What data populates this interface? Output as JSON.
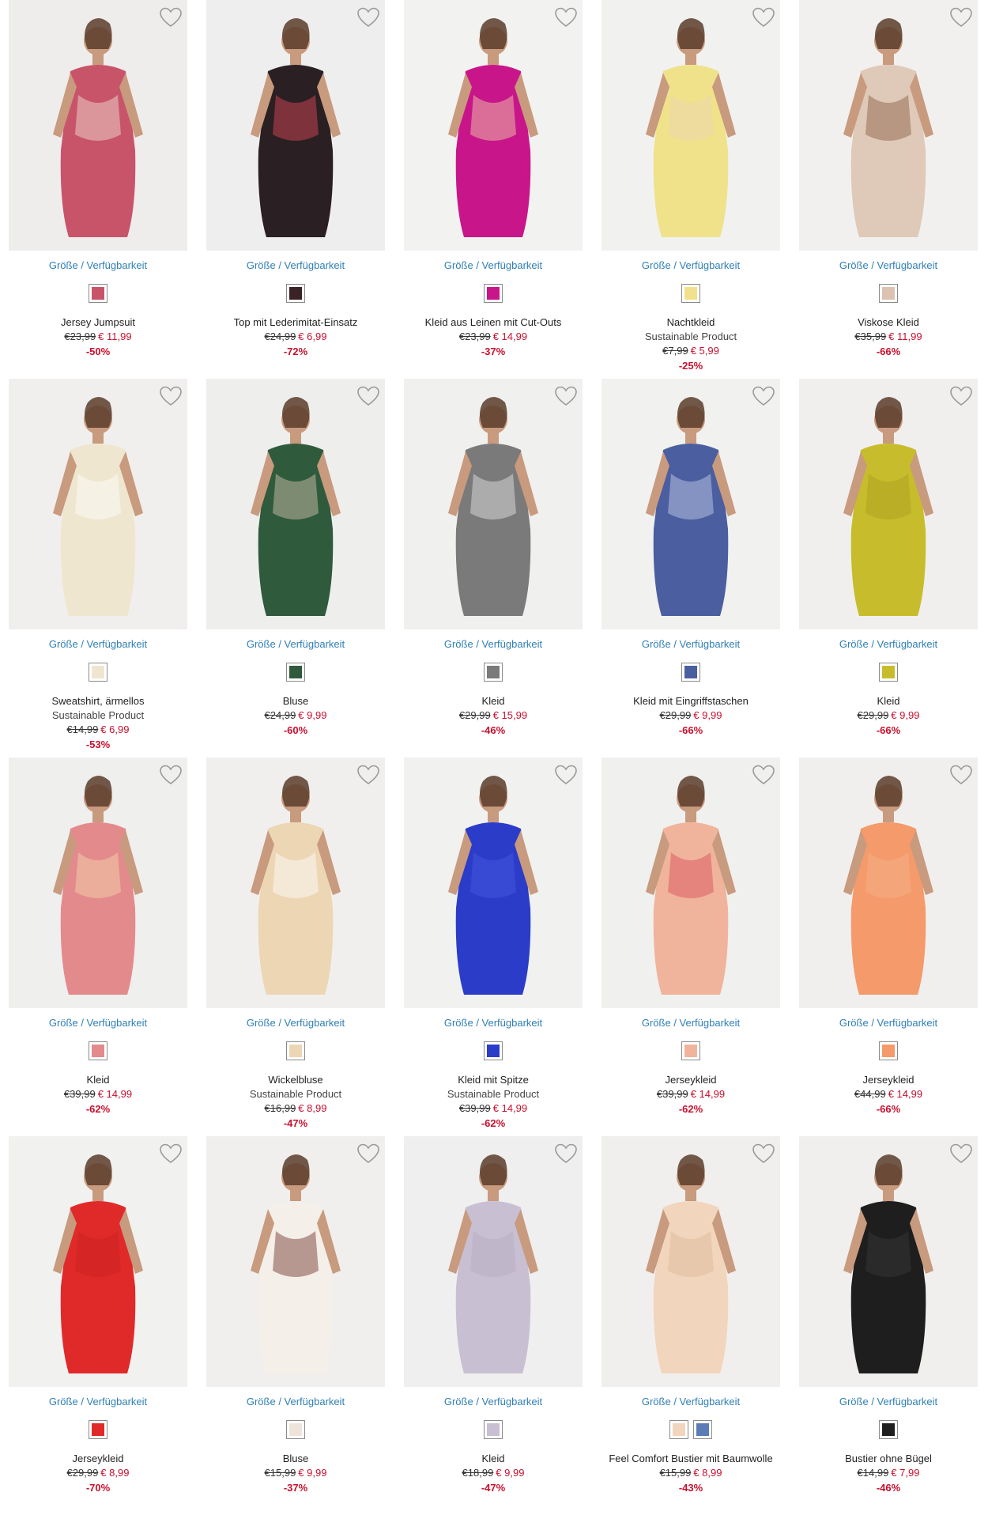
{
  "size_link_label": "Größe / Verfügbarkeit",
  "colors": {
    "link": "#2f7fb5",
    "sale": "#c8102e"
  },
  "products": [
    {
      "name": "Jersey Jumpsuit",
      "sub": "",
      "old": "€23,99",
      "new": "€ 11,99",
      "disc": "-50%",
      "bg": "#efedec",
      "fill": "#c8546a",
      "accent": "#f2e6d6",
      "swatches": [
        "#c8546a"
      ]
    },
    {
      "name": "Top mit Lederimitat-Einsatz",
      "sub": "",
      "old": "€24,99",
      "new": "€ 6,99",
      "disc": "-72%",
      "bg": "#eeeeee",
      "fill": "#2a1f22",
      "accent": "#e5495b",
      "swatches": [
        "#3a2226"
      ]
    },
    {
      "name": "Kleid aus Leinen mit Cut-Outs",
      "sub": "",
      "old": "€23,99",
      "new": "€ 14,99",
      "disc": "-37%",
      "bg": "#f2f2f0",
      "fill": "#c8168a",
      "accent": "#f0d9a8",
      "swatches": [
        "#c8168a"
      ]
    },
    {
      "name": "Nachtkleid",
      "sub": "Sustainable Product",
      "old": "€7,99",
      "new": "€ 5,99",
      "disc": "-25%",
      "bg": "#f1f1f0",
      "fill": "#f0e28a",
      "accent": "#e9d5b4",
      "swatches": [
        "#f2e18c"
      ]
    },
    {
      "name": "Viskose Kleid",
      "sub": "",
      "old": "€35,99",
      "new": "€ 11,99",
      "disc": "-66%",
      "bg": "#f1f0ee",
      "fill": "#dfc9b8",
      "accent": "#8a5a40",
      "swatches": [
        "#dcc2b0"
      ]
    },
    {
      "name": "Sweatshirt, ärmellos",
      "sub": "Sustainable Product",
      "old": "€14,99",
      "new": "€ 6,99",
      "disc": "-53%",
      "bg": "#f0efed",
      "fill": "#efe6cf",
      "accent": "#ffffff",
      "swatches": [
        "#efe6cf"
      ]
    },
    {
      "name": "Bluse",
      "sub": "",
      "old": "€24,99",
      "new": "€ 9,99",
      "disc": "-60%",
      "bg": "#eeeeec",
      "fill": "#2f5a3c",
      "accent": "#e0c8b6",
      "swatches": [
        "#2f5a3c"
      ]
    },
    {
      "name": "Kleid",
      "sub": "",
      "old": "€29,99",
      "new": "€ 15,99",
      "disc": "-46%",
      "bg": "#f0f0ee",
      "fill": "#7a7a7a",
      "accent": "#e8e8e8",
      "swatches": [
        "#7a7a7a"
      ]
    },
    {
      "name": "Kleid mit Eingriffstaschen",
      "sub": "",
      "old": "€29,99",
      "new": "€ 9,99",
      "disc": "-66%",
      "bg": "#f1f1f0",
      "fill": "#4a5ea0",
      "accent": "#cfd5ea",
      "swatches": [
        "#4a5ea0"
      ]
    },
    {
      "name": "Kleid",
      "sub": "",
      "old": "€29,99",
      "new": "€ 9,99",
      "disc": "-66%",
      "bg": "#f0efed",
      "fill": "#c7bd2c",
      "accent": "#a89c20",
      "swatches": [
        "#c7bd2c"
      ]
    },
    {
      "name": "Kleid",
      "sub": "",
      "old": "€39,99",
      "new": "€ 14,99",
      "disc": "-62%",
      "bg": "#efefee",
      "fill": "#e38a8d",
      "accent": "#f1d9ad",
      "swatches": [
        "#e38a8d"
      ]
    },
    {
      "name": "Wickelbluse",
      "sub": "Sustainable Product",
      "old": "€16,99",
      "new": "€ 8,99",
      "disc": "-47%",
      "bg": "#f0efed",
      "fill": "#ecd6b4",
      "accent": "#ffffff",
      "swatches": [
        "#ecd6b4"
      ]
    },
    {
      "name": "Kleid mit Spitze",
      "sub": "Sustainable Product",
      "old": "€39,99",
      "new": "€ 14,99",
      "disc": "-62%",
      "bg": "#f1f1f0",
      "fill": "#2b3dc8",
      "accent": "#4a5be0",
      "swatches": [
        "#2b3dc8"
      ]
    },
    {
      "name": "Jerseykleid",
      "sub": "",
      "old": "€39,99",
      "new": "€ 14,99",
      "disc": "-62%",
      "bg": "#f0f0ee",
      "fill": "#f0b49c",
      "accent": "#d84a58",
      "swatches": [
        "#f0b49c"
      ]
    },
    {
      "name": "Jerseykleid",
      "sub": "",
      "old": "€44,99",
      "new": "€ 14,99",
      "disc": "-66%",
      "bg": "#f0efed",
      "fill": "#f49a6b",
      "accent": "#f7b48e",
      "swatches": [
        "#f49a6b"
      ]
    },
    {
      "name": "Jerseykleid",
      "sub": "",
      "old": "€29,99",
      "new": "€ 8,99",
      "disc": "-70%",
      "bg": "#f1f1f0",
      "fill": "#e02a2a",
      "accent": "#c81e1e",
      "swatches": [
        "#e02a2a"
      ]
    },
    {
      "name": "Bluse",
      "sub": "",
      "old": "€15,99",
      "new": "€ 9,99",
      "disc": "-37%",
      "bg": "#f0efed",
      "fill": "#f4efe8",
      "accent": "#6a2e28",
      "swatches": [
        "#efe4dc"
      ]
    },
    {
      "name": "Kleid",
      "sub": "",
      "old": "€18,99",
      "new": "€ 9,99",
      "disc": "-47%",
      "bg": "#efefef",
      "fill": "#c8bfd2",
      "accent": "#b3aac0",
      "swatches": [
        "#c8bfd2"
      ]
    },
    {
      "name": "Feel Comfort Bustier mit Baumwolle",
      "sub": "",
      "old": "€15,99",
      "new": "€ 8,99",
      "disc": "-43%",
      "bg": "#f1efed",
      "fill": "#f2d5bd",
      "accent": "#d9b79a",
      "swatches": [
        "#f2d5bd",
        "#5a7db8"
      ]
    },
    {
      "name": "Bustier ohne Bügel",
      "sub": "",
      "old": "€14,99",
      "new": "€ 7,99",
      "disc": "-46%",
      "bg": "#f0efed",
      "fill": "#1e1e1e",
      "accent": "#3a3a3a",
      "swatches": [
        "#1e1e1e"
      ]
    }
  ]
}
